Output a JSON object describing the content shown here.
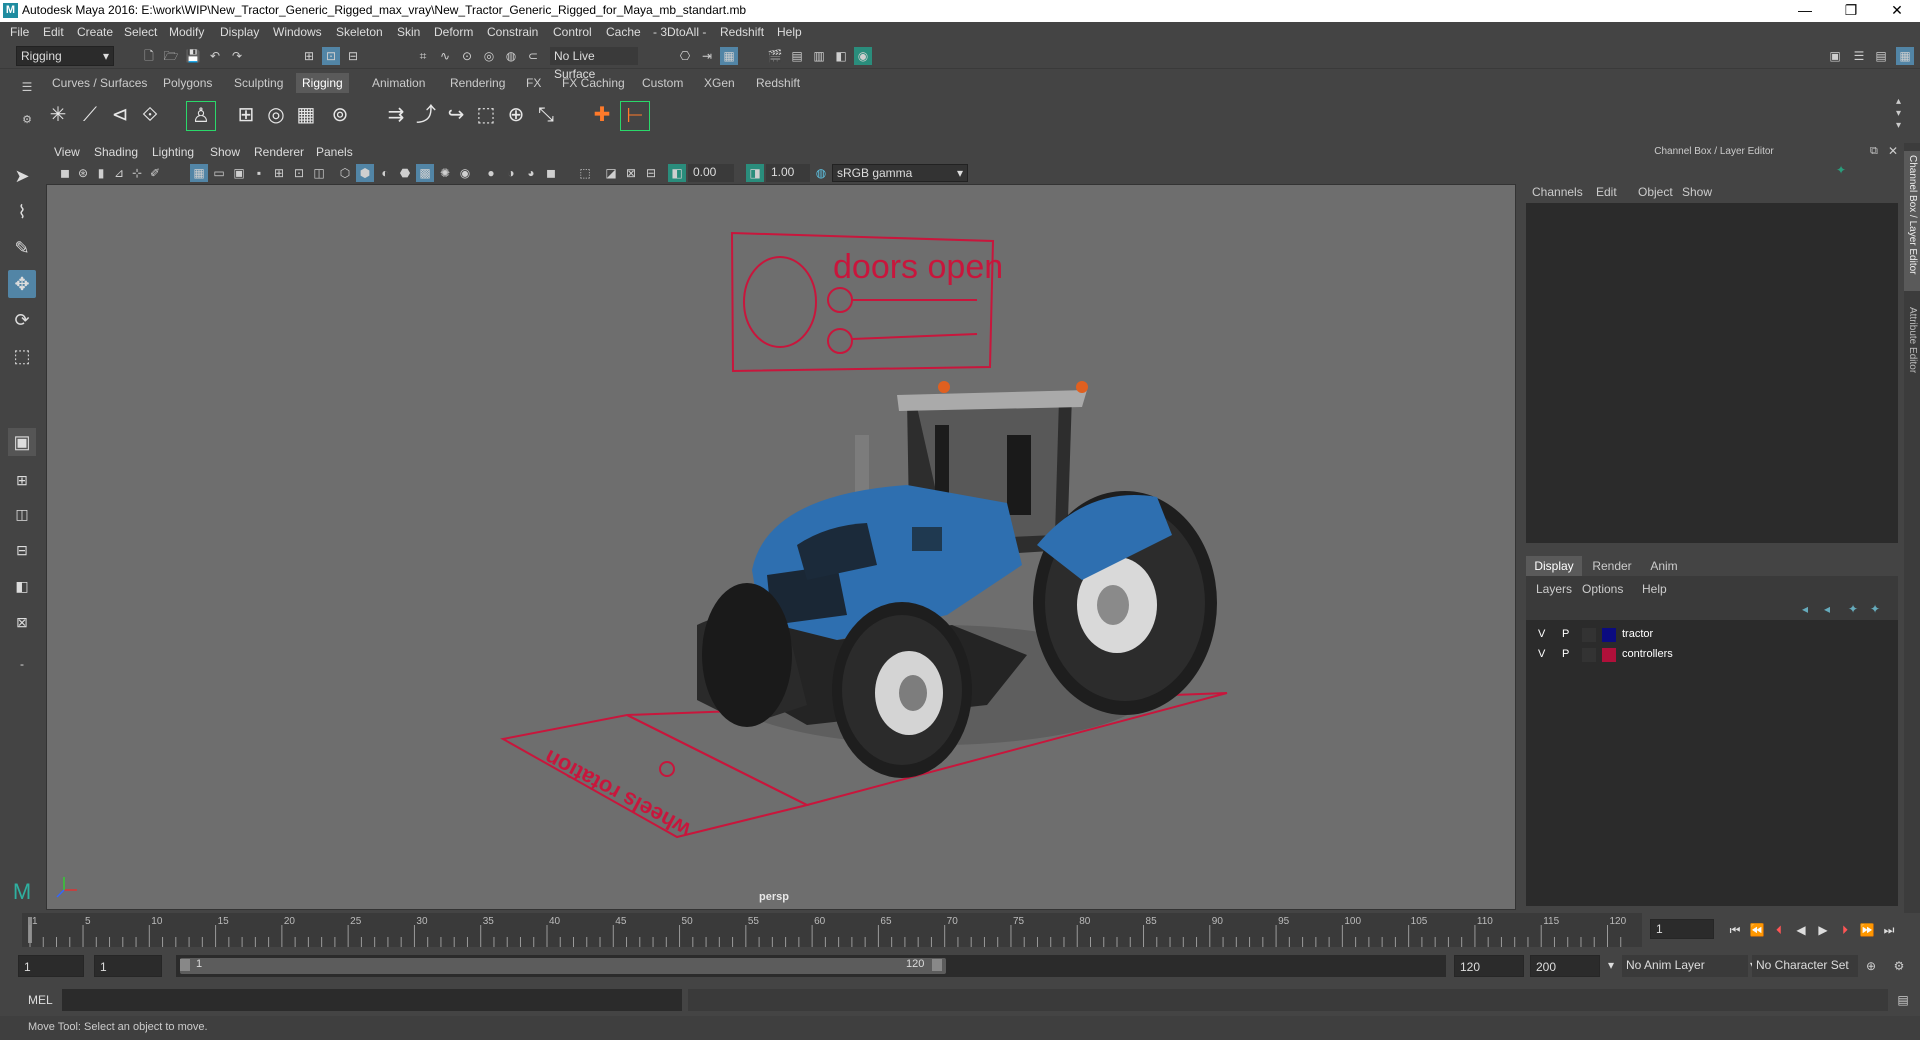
{
  "window": {
    "title": "Autodesk Maya 2016: E:\\work\\WIP\\New_Tractor_Generic_Rigged_max_vray\\New_Tractor_Generic_Rigged_for_Maya_mb_standart.mb",
    "controls": [
      "—",
      "❐",
      "✕"
    ]
  },
  "menubar": [
    "File",
    "Edit",
    "Create",
    "Select",
    "Modify",
    "Display",
    "Windows",
    "Skeleton",
    "Skin",
    "Deform",
    "Constrain",
    "Control",
    "Cache",
    "- 3DtoAll -",
    "Redshift",
    "Help"
  ],
  "statusline": {
    "mode": "Rigging",
    "live_surface": "No Live Surface"
  },
  "shelf": {
    "tabs": [
      "Curves / Surfaces",
      "Polygons",
      "Sculpting",
      "Rigging",
      "Animation",
      "Rendering",
      "FX",
      "FX Caching",
      "Custom",
      "XGen",
      "Redshift"
    ],
    "active_tab": "Rigging"
  },
  "viewport": {
    "menus": [
      "View",
      "Shading",
      "Lighting",
      "Show",
      "Renderer",
      "Panels"
    ],
    "near": "0.00",
    "far": "1.00",
    "color_space": "sRGB gamma",
    "camera": "persp",
    "labels": {
      "doors": "doors open",
      "wheels": "wheels rotation"
    },
    "colors": {
      "bg": "#6e6e6e",
      "control": "#c8163c",
      "tractor_blue": "#2e6fb0"
    }
  },
  "channel_box": {
    "title": "Channel Box / Layer Editor",
    "menus": [
      "Channels",
      "Edit",
      "Object",
      "Show"
    ]
  },
  "layer_editor": {
    "tabs": [
      "Display",
      "Render",
      "Anim"
    ],
    "active": "Display",
    "menus": [
      "Layers",
      "Options",
      "Help"
    ],
    "layers": [
      {
        "v": "V",
        "p": "P",
        "color": "#0b0b80",
        "name": "tractor"
      },
      {
        "v": "V",
        "p": "P",
        "color": "#b0103a",
        "name": "controllers"
      }
    ]
  },
  "side_tabs": [
    "Channel Box / Layer Editor",
    "Attribute Editor"
  ],
  "timeline": {
    "ticks": [
      "1",
      "5",
      "10",
      "15",
      "20",
      "25",
      "30",
      "35",
      "40",
      "45",
      "50",
      "55",
      "60",
      "65",
      "70",
      "75",
      "80",
      "85",
      "90",
      "95",
      "100",
      "105",
      "110",
      "115",
      "120"
    ],
    "current_frame": "1"
  },
  "range": {
    "start": "1",
    "playback_start": "1",
    "slider_start": "1",
    "slider_end": "120",
    "playback_end": "120",
    "end": "200",
    "anim_layer": "No Anim Layer",
    "character_set": "No Character Set"
  },
  "mel": {
    "label": "MEL"
  },
  "help_line": "Move Tool: Select an object to move."
}
